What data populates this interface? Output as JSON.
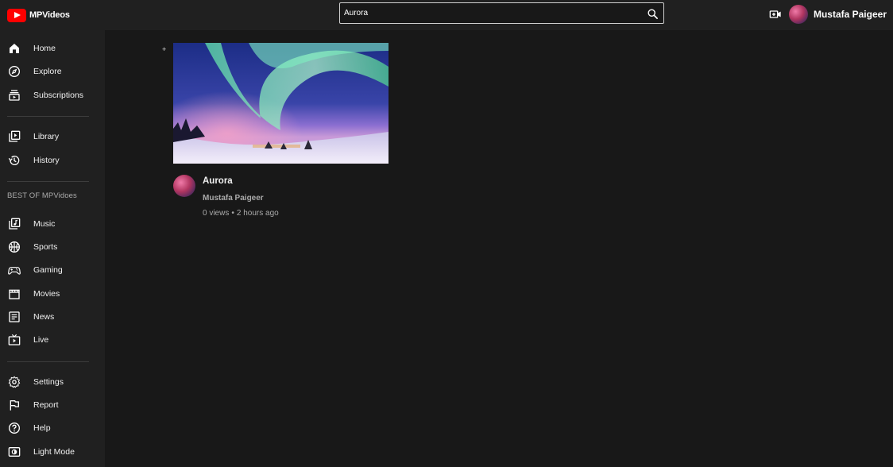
{
  "app": {
    "name": "MPVideos"
  },
  "search": {
    "value": "Aurora",
    "placeholder": "Search"
  },
  "user": {
    "name": "Mustafa Paigeer"
  },
  "sidebar": {
    "section_title": "BEST OF MPVidoes",
    "items": [
      {
        "label": "Home",
        "icon": "home-icon"
      },
      {
        "label": "Explore",
        "icon": "compass-icon"
      },
      {
        "label": "Subscriptions",
        "icon": "subscriptions-icon"
      },
      {
        "label": "Library",
        "icon": "library-icon"
      },
      {
        "label": "History",
        "icon": "history-icon"
      },
      {
        "label": "Music",
        "icon": "music-icon"
      },
      {
        "label": "Sports",
        "icon": "sports-icon"
      },
      {
        "label": "Gaming",
        "icon": "gamepad-icon"
      },
      {
        "label": "Movies",
        "icon": "clapperboard-icon"
      },
      {
        "label": "News",
        "icon": "news-icon"
      },
      {
        "label": "Live",
        "icon": "live-icon"
      },
      {
        "label": "Settings",
        "icon": "gear-icon"
      },
      {
        "label": "Report",
        "icon": "flag-icon"
      },
      {
        "label": "Help",
        "icon": "help-icon"
      },
      {
        "label": "Light Mode",
        "icon": "light-mode-icon"
      }
    ]
  },
  "results": [
    {
      "title": "Aurora",
      "channel": "Mustafa Paigeer",
      "views": "0 views",
      "separator": "•",
      "age": "2 hours ago",
      "thumbnail": "aurora-landscape"
    }
  ],
  "colors": {
    "background": "#181818",
    "surface": "#202020",
    "brand_red": "#ff0000",
    "text_primary": "#f1f1f1",
    "text_secondary": "#aaaaaa"
  }
}
